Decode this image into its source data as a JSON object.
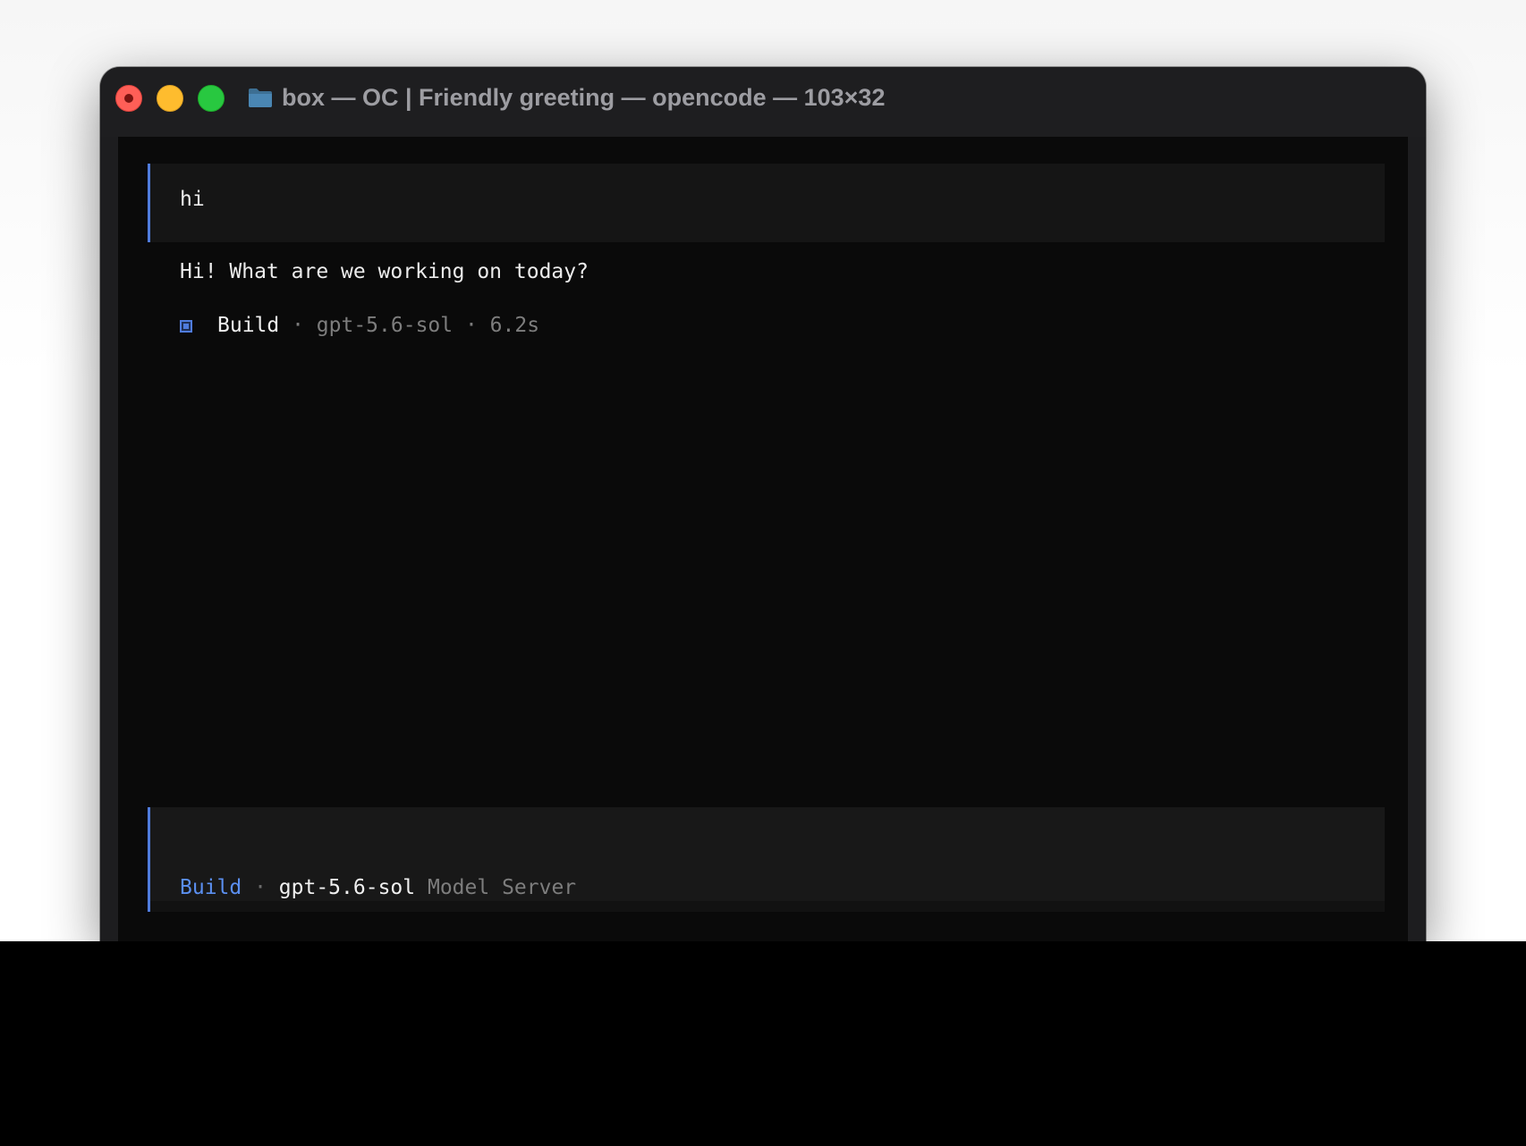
{
  "window": {
    "title": "box — OC | Friendly greeting — opencode — 103×32"
  },
  "conversation": {
    "user_message": "hi",
    "assistant_reply": "Hi! What are we working on today?",
    "meta": {
      "agent": "Build",
      "separator": " · ",
      "model": "gpt-5.6-sol",
      "duration": "6.2s"
    }
  },
  "input": {
    "agent": "Build",
    "separator": " · ",
    "model": "gpt-5.6-sol",
    "provider": "Model Server"
  },
  "colors": {
    "accent": "#4f7cdd",
    "agent_label": "#5b8ff0",
    "terminal_bg": "#0a0a0a",
    "text": "#ececec",
    "dim_text": "#7d7d7d"
  },
  "icons": {
    "title_icon": "folder-icon",
    "meta_icon": "square-icon"
  }
}
